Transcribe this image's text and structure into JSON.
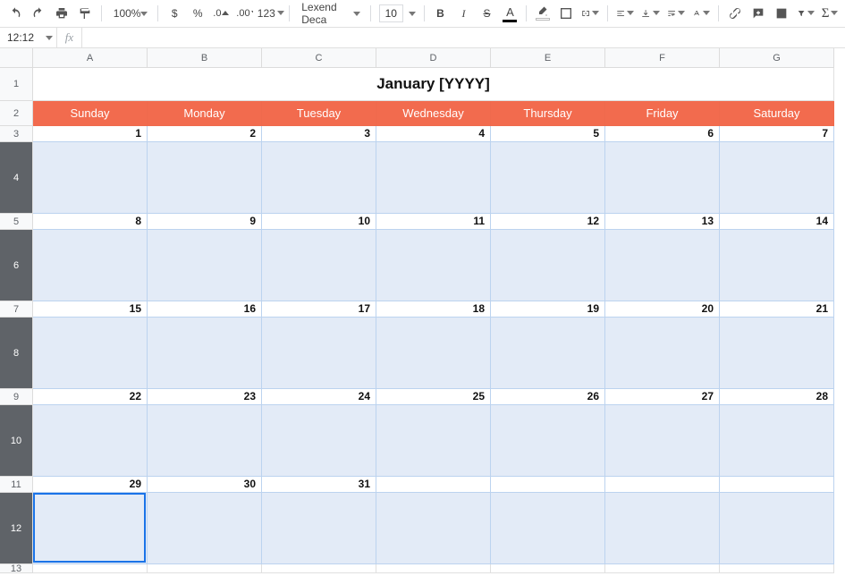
{
  "toolbar": {
    "zoom": "100%",
    "currency": "$",
    "percent": "%",
    "dec_dec": ".0",
    "inc_dec": ".00",
    "numfmt": "123",
    "font": "Lexend Deca",
    "font_size": "10",
    "bold": "B",
    "italic": "I",
    "strike": "S",
    "textcolor": "A"
  },
  "namebox": "12:12",
  "fx_label": "fx",
  "columns": [
    "A",
    "B",
    "C",
    "D",
    "E",
    "F",
    "G"
  ],
  "rows": {
    "r1": "1",
    "r2": "2",
    "r3": "3",
    "r4": "4",
    "r5": "5",
    "r6": "6",
    "r7": "7",
    "r8": "8",
    "r9": "9",
    "r10": "10",
    "r11": "11",
    "r12": "12",
    "r13": "13"
  },
  "calendar": {
    "title": "January [YYYY]",
    "dow": [
      "Sunday",
      "Monday",
      "Tuesday",
      "Wednesday",
      "Thursday",
      "Friday",
      "Saturday"
    ],
    "weeks": [
      [
        "1",
        "2",
        "3",
        "4",
        "5",
        "6",
        "7"
      ],
      [
        "8",
        "9",
        "10",
        "11",
        "12",
        "13",
        "14"
      ],
      [
        "15",
        "16",
        "17",
        "18",
        "19",
        "20",
        "21"
      ],
      [
        "22",
        "23",
        "24",
        "25",
        "26",
        "27",
        "28"
      ],
      [
        "29",
        "30",
        "31",
        "",
        "",
        "",
        ""
      ]
    ]
  },
  "colors": {
    "accent": "#F26B4E",
    "week_bg": "#E3EBF7",
    "selection": "#1a73e8"
  }
}
